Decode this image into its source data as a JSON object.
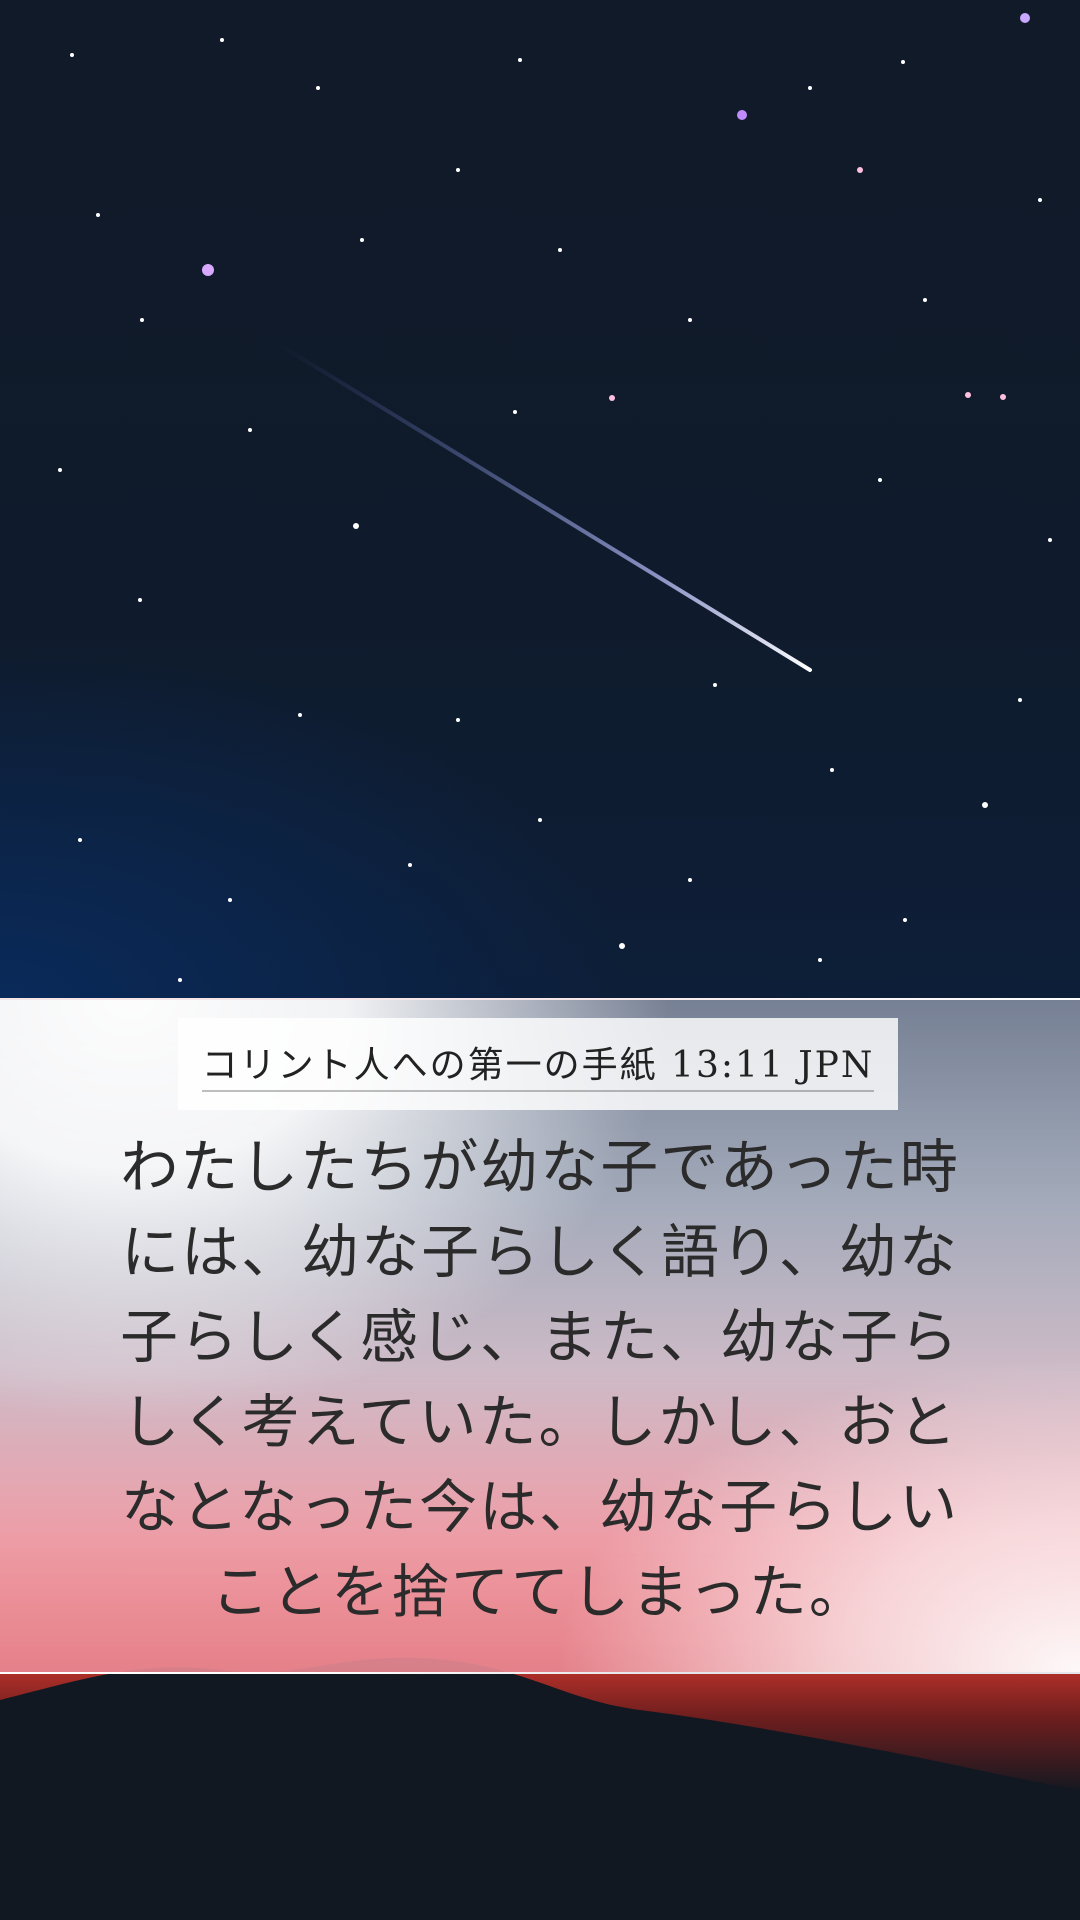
{
  "scene": {
    "description_icons": [
      "night-sky",
      "shooting-star",
      "stars",
      "sunset-sky",
      "mountain-silhouette"
    ]
  },
  "verse": {
    "reference": "コリント人への第一の手紙 13:11 JPN",
    "lines": [
      "わたしたちが幼な子であった時",
      "には、幼な子らしく語り、幼な",
      "子らしく感じ、また、幼な子ら",
      "しく考えていた。しかし、おと",
      "なとなった今は、幼な子らしい",
      "ことを捨ててしまった。"
    ]
  },
  "colors": {
    "night_sky": "#101a28",
    "sunset_red": "#d83a30",
    "text": "#2b2b2b"
  }
}
